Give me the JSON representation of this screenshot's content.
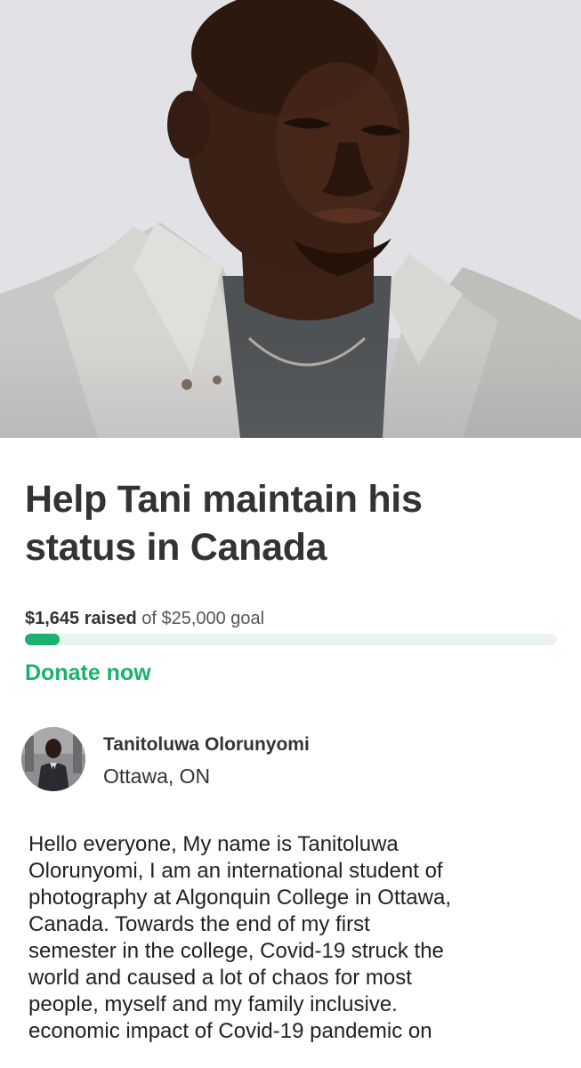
{
  "campaign": {
    "title_line1": "Help Tani maintain his",
    "title_line2": "status in Canada",
    "raised_amount": "$1,645 raised",
    "goal_text": "of $25,000 goal",
    "progress_fraction": 0.0658,
    "donate_label": "Donate now"
  },
  "organizer": {
    "name": "Tanitoluwa Olorunyomi",
    "location": "Ottawa, ON"
  },
  "story": {
    "lines": [
      "Hello everyone, My name is Tanitoluwa",
      "Olorunyomi, I am an international student of",
      "photography at Algonquin College in Ottawa,",
      "Canada. Towards the end of my first",
      "semester in the college, Covid-19 struck the",
      "world and caused a lot of chaos for most",
      "people, myself and my family inclusive.",
      "economic impact of Covid-19 pandemic on"
    ]
  },
  "colors": {
    "accent": "#18b36b",
    "progress_track": "#ebf3ee",
    "text": "#333333"
  }
}
